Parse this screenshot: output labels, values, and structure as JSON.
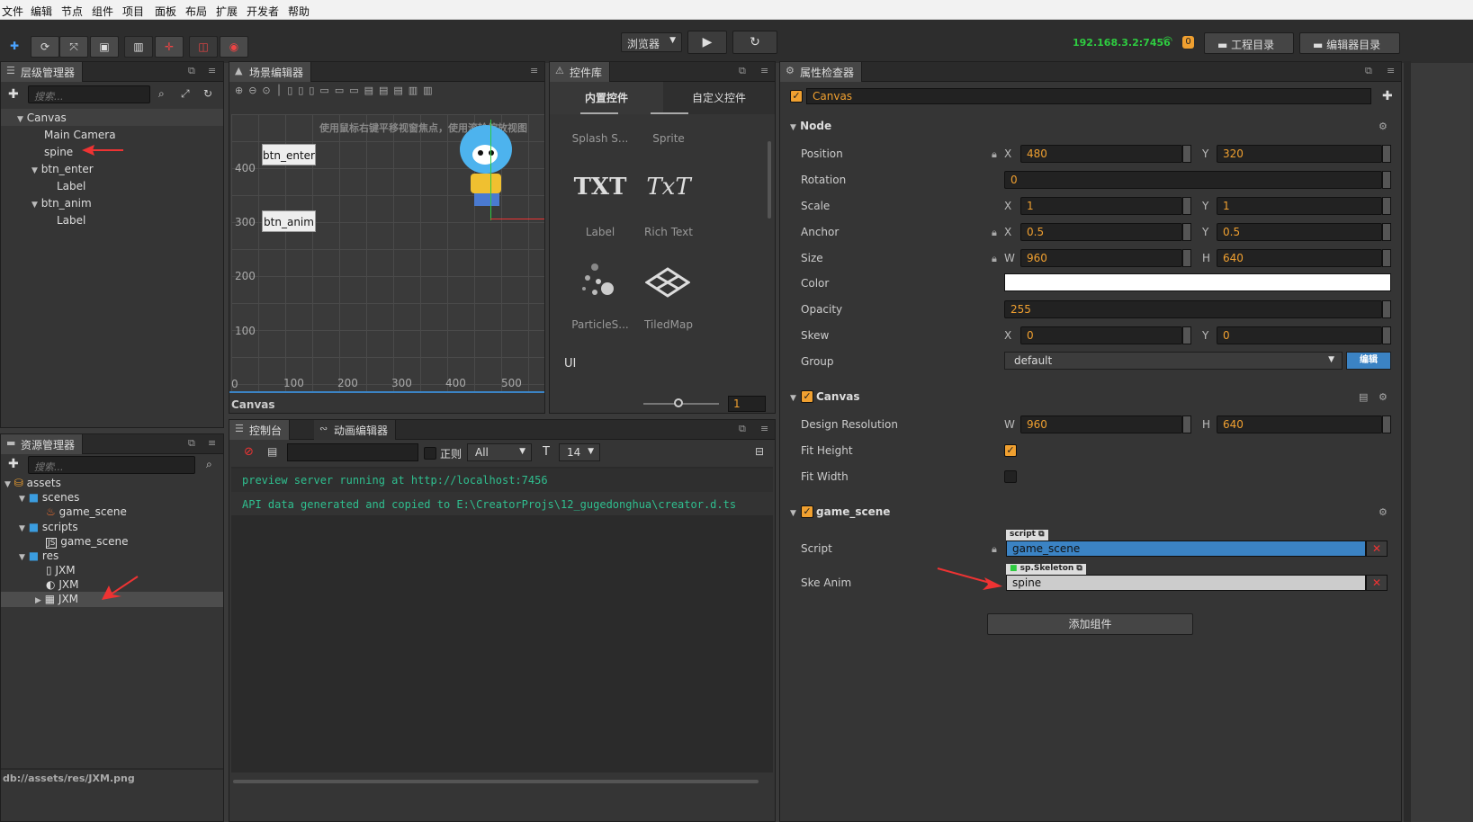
{
  "menu": [
    "文件",
    "编辑",
    "节点",
    "组件",
    "项目",
    "面板",
    "布局",
    "扩展",
    "开发者",
    "帮助"
  ],
  "toolbar": {
    "browser_label": "浏览器",
    "ip": "192.168.3.2:7456",
    "badge": "0",
    "project_dir": "工程目录",
    "editor_dir": "编辑器目录"
  },
  "hierarchy": {
    "title": "层级管理器",
    "search_placeholder": "搜索...",
    "items": [
      "Canvas",
      "Main Camera",
      "spine",
      "btn_enter",
      "Label",
      "btn_anim",
      "Label"
    ]
  },
  "scene": {
    "title": "场景编辑器",
    "hint": "使用鼠标右键平移视窗焦点，使用滚轮缩放视图",
    "btn_enter": "btn_enter",
    "btn_anim": "btn_anim",
    "y_ticks": [
      "400",
      "300",
      "200",
      "100"
    ],
    "x_ticks": [
      "0",
      "100",
      "200",
      "300",
      "400",
      "500"
    ],
    "footer": "Canvas"
  },
  "widgets": {
    "title": "控件库",
    "tab_builtin": "内置控件",
    "tab_custom": "自定义控件",
    "items": [
      "Splash S...",
      "Sprite",
      "Label",
      "Rich Text",
      "ParticleS...",
      "TiledMap"
    ],
    "section_ui": "UI",
    "label_glyph": "TXT",
    "richtext_glyph": "TxT",
    "zoom_value": "1"
  },
  "assets": {
    "title": "资源管理器",
    "search_placeholder": "搜索...",
    "items": [
      "assets",
      "scenes",
      "game_scene",
      "scripts",
      "game_scene",
      "res",
      "JXM",
      "JXM",
      "JXM"
    ],
    "status": "db://assets/res/JXM.png"
  },
  "console": {
    "tab_console": "控制台",
    "tab_anim": "动画编辑器",
    "regex_label": "正则",
    "filter_value": "All",
    "font_size": "14",
    "lines": [
      "preview server running at http://localhost:7456",
      "API data generated and copied to E:\\CreatorProjs\\12_gugedonghua\\creator.d.ts"
    ]
  },
  "inspector": {
    "title": "属性检查器",
    "node_name": "Canvas",
    "node_section": "Node",
    "position": {
      "label": "Position",
      "x": "480",
      "y": "320"
    },
    "rotation": {
      "label": "Rotation",
      "value": "0"
    },
    "scale": {
      "label": "Scale",
      "x": "1",
      "y": "1"
    },
    "anchor": {
      "label": "Anchor",
      "x": "0.5",
      "y": "0.5"
    },
    "size": {
      "label": "Size",
      "w": "960",
      "h": "640"
    },
    "color": {
      "label": "Color",
      "value": "#ffffff"
    },
    "opacity": {
      "label": "Opacity",
      "value": "255"
    },
    "skew": {
      "label": "Skew",
      "x": "0",
      "y": "0"
    },
    "group": {
      "label": "Group",
      "value": "default",
      "edit": "编辑"
    },
    "canvas_section": "Canvas",
    "design_resolution": {
      "label": "Design Resolution",
      "w": "960",
      "h": "640"
    },
    "fit_height": {
      "label": "Fit Height",
      "checked": true
    },
    "fit_width": {
      "label": "Fit Width",
      "checked": false
    },
    "game_scene_section": "game_scene",
    "script": {
      "label": "Script",
      "tag": "script",
      "value": "game_scene"
    },
    "ske_anim": {
      "label": "Ske Anim",
      "tag": "sp.Skeleton",
      "value": "spine"
    },
    "add_component": "添加组件",
    "axis_x": "X",
    "axis_y": "Y",
    "axis_w": "W",
    "axis_h": "H"
  },
  "colors": {
    "accent": "#f0a030",
    "blue": "#3b83c4",
    "green": "#2ecc40",
    "console_text": "#2fbf8f"
  }
}
